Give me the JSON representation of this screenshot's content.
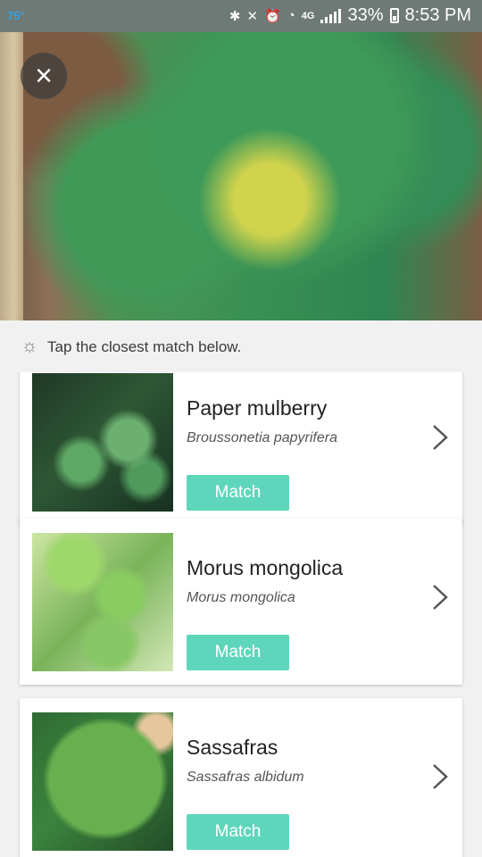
{
  "status_bar": {
    "temperature": "75°",
    "network": "4G",
    "battery": "33%",
    "time": "8:53 PM"
  },
  "header": {
    "close_icon": "close-icon"
  },
  "hint": {
    "text": "Tap the closest match below."
  },
  "results": [
    {
      "name": "Paper mulberry",
      "scientific": "Broussonetia papyrifera",
      "button": "Match"
    },
    {
      "name": "Morus mongolica",
      "scientific": "Morus mongolica",
      "button": "Match"
    },
    {
      "name": "Sassafras",
      "scientific": "Sassafras albidum",
      "button": "Match"
    }
  ],
  "colors": {
    "accent": "#5ed6bb",
    "status_bar": "#6f7a76"
  }
}
